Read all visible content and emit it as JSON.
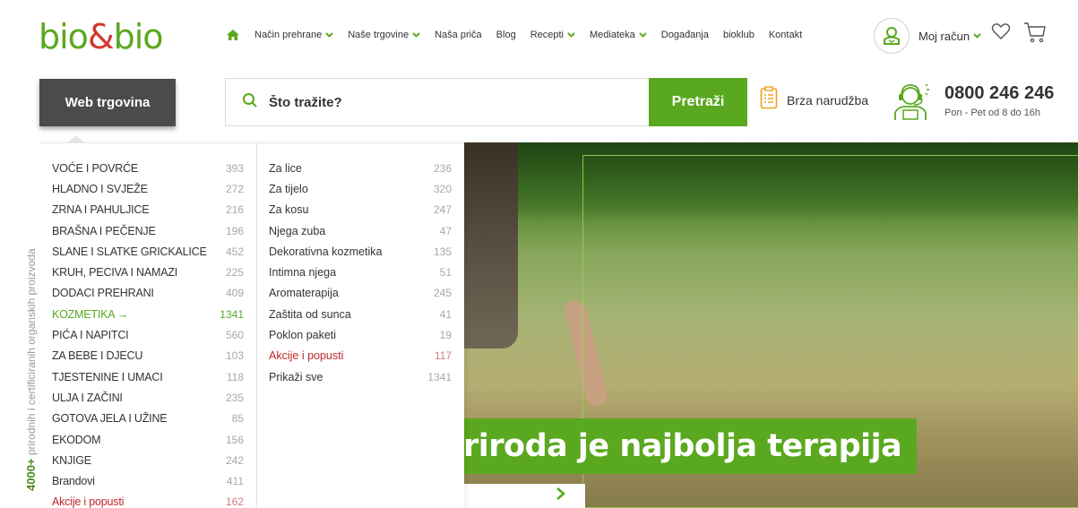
{
  "logo": {
    "part1": "bio",
    "amp": "&",
    "part2": "bio"
  },
  "nav": {
    "items": [
      {
        "label": "Način prehrane",
        "dropdown": true
      },
      {
        "label": "Naše trgovine",
        "dropdown": true
      },
      {
        "label": "Naša priča",
        "dropdown": false
      },
      {
        "label": "Blog",
        "dropdown": false
      },
      {
        "label": "Recepti",
        "dropdown": true
      },
      {
        "label": "Mediateka",
        "dropdown": true
      },
      {
        "label": "Događanja",
        "dropdown": false
      },
      {
        "label": "bioklub",
        "dropdown": false
      },
      {
        "label": "Kontakt",
        "dropdown": false
      }
    ],
    "account_label": "Moj račun"
  },
  "toolbar": {
    "webshop_label": "Web trgovina",
    "search_placeholder": "Što tražite?",
    "search_button": "Pretraži",
    "quick_order": "Brza narudžba",
    "phone": "0800 246 246",
    "hours": "Pon - Pet od 8 do 16h"
  },
  "categories": [
    {
      "label": "VOĆE I POVRĆE",
      "count": "393"
    },
    {
      "label": "HLADNO I SVJEŽE",
      "count": "272"
    },
    {
      "label": "ZRNA I PAHULJICE",
      "count": "216"
    },
    {
      "label": "BRAŠNA I PEČENJE",
      "count": "196"
    },
    {
      "label": "SLANE I SLATKE GRICKALICE",
      "count": "452"
    },
    {
      "label": "KRUH, PECIVA I NAMAZI",
      "count": "225"
    },
    {
      "label": "DODACI PREHRANI",
      "count": "409"
    },
    {
      "label": "KOZMETIKA →",
      "count": "1341",
      "active": true
    },
    {
      "label": "PIĆA I NAPITCI",
      "count": "560"
    },
    {
      "label": "ZA BEBE I DJECU",
      "count": "103"
    },
    {
      "label": "TJESTENINE I UMACI",
      "count": "118"
    },
    {
      "label": "ULJA I ZAČINI",
      "count": "235"
    },
    {
      "label": "GOTOVA JELA I UŽINE",
      "count": "85"
    },
    {
      "label": "EKODOM",
      "count": "156"
    },
    {
      "label": "KNJIGE",
      "count": "242"
    },
    {
      "label": "Brandovi",
      "count": "411"
    },
    {
      "label": "Akcije i popusti",
      "count": "162",
      "sale": true
    }
  ],
  "subcategories": [
    {
      "label": "Za lice",
      "count": "236"
    },
    {
      "label": "Za tijelo",
      "count": "320"
    },
    {
      "label": "Za kosu",
      "count": "247"
    },
    {
      "label": "Njega zuba",
      "count": "47"
    },
    {
      "label": "Dekorativna kozmetika",
      "count": "135"
    },
    {
      "label": "Intimna njega",
      "count": "51"
    },
    {
      "label": "Aromaterapija",
      "count": "245"
    },
    {
      "label": "Zaštita od sunca",
      "count": "41"
    },
    {
      "label": "Poklon paketi",
      "count": "19"
    },
    {
      "label": "Akcije i popusti",
      "count": "117",
      "sale": true
    },
    {
      "label": "Prikaži sve",
      "count": "1341"
    }
  ],
  "hero": {
    "title": "riroda je najbolja terapija"
  },
  "side_tag": {
    "strong": "4000+",
    "text": " prirodnih i certificiranih organskih proizvoda"
  },
  "colors": {
    "brand_green": "#5aa81f",
    "brand_red": "#d2372c",
    "dark_button": "#4b4b4b",
    "sale_red": "#c0262a"
  }
}
